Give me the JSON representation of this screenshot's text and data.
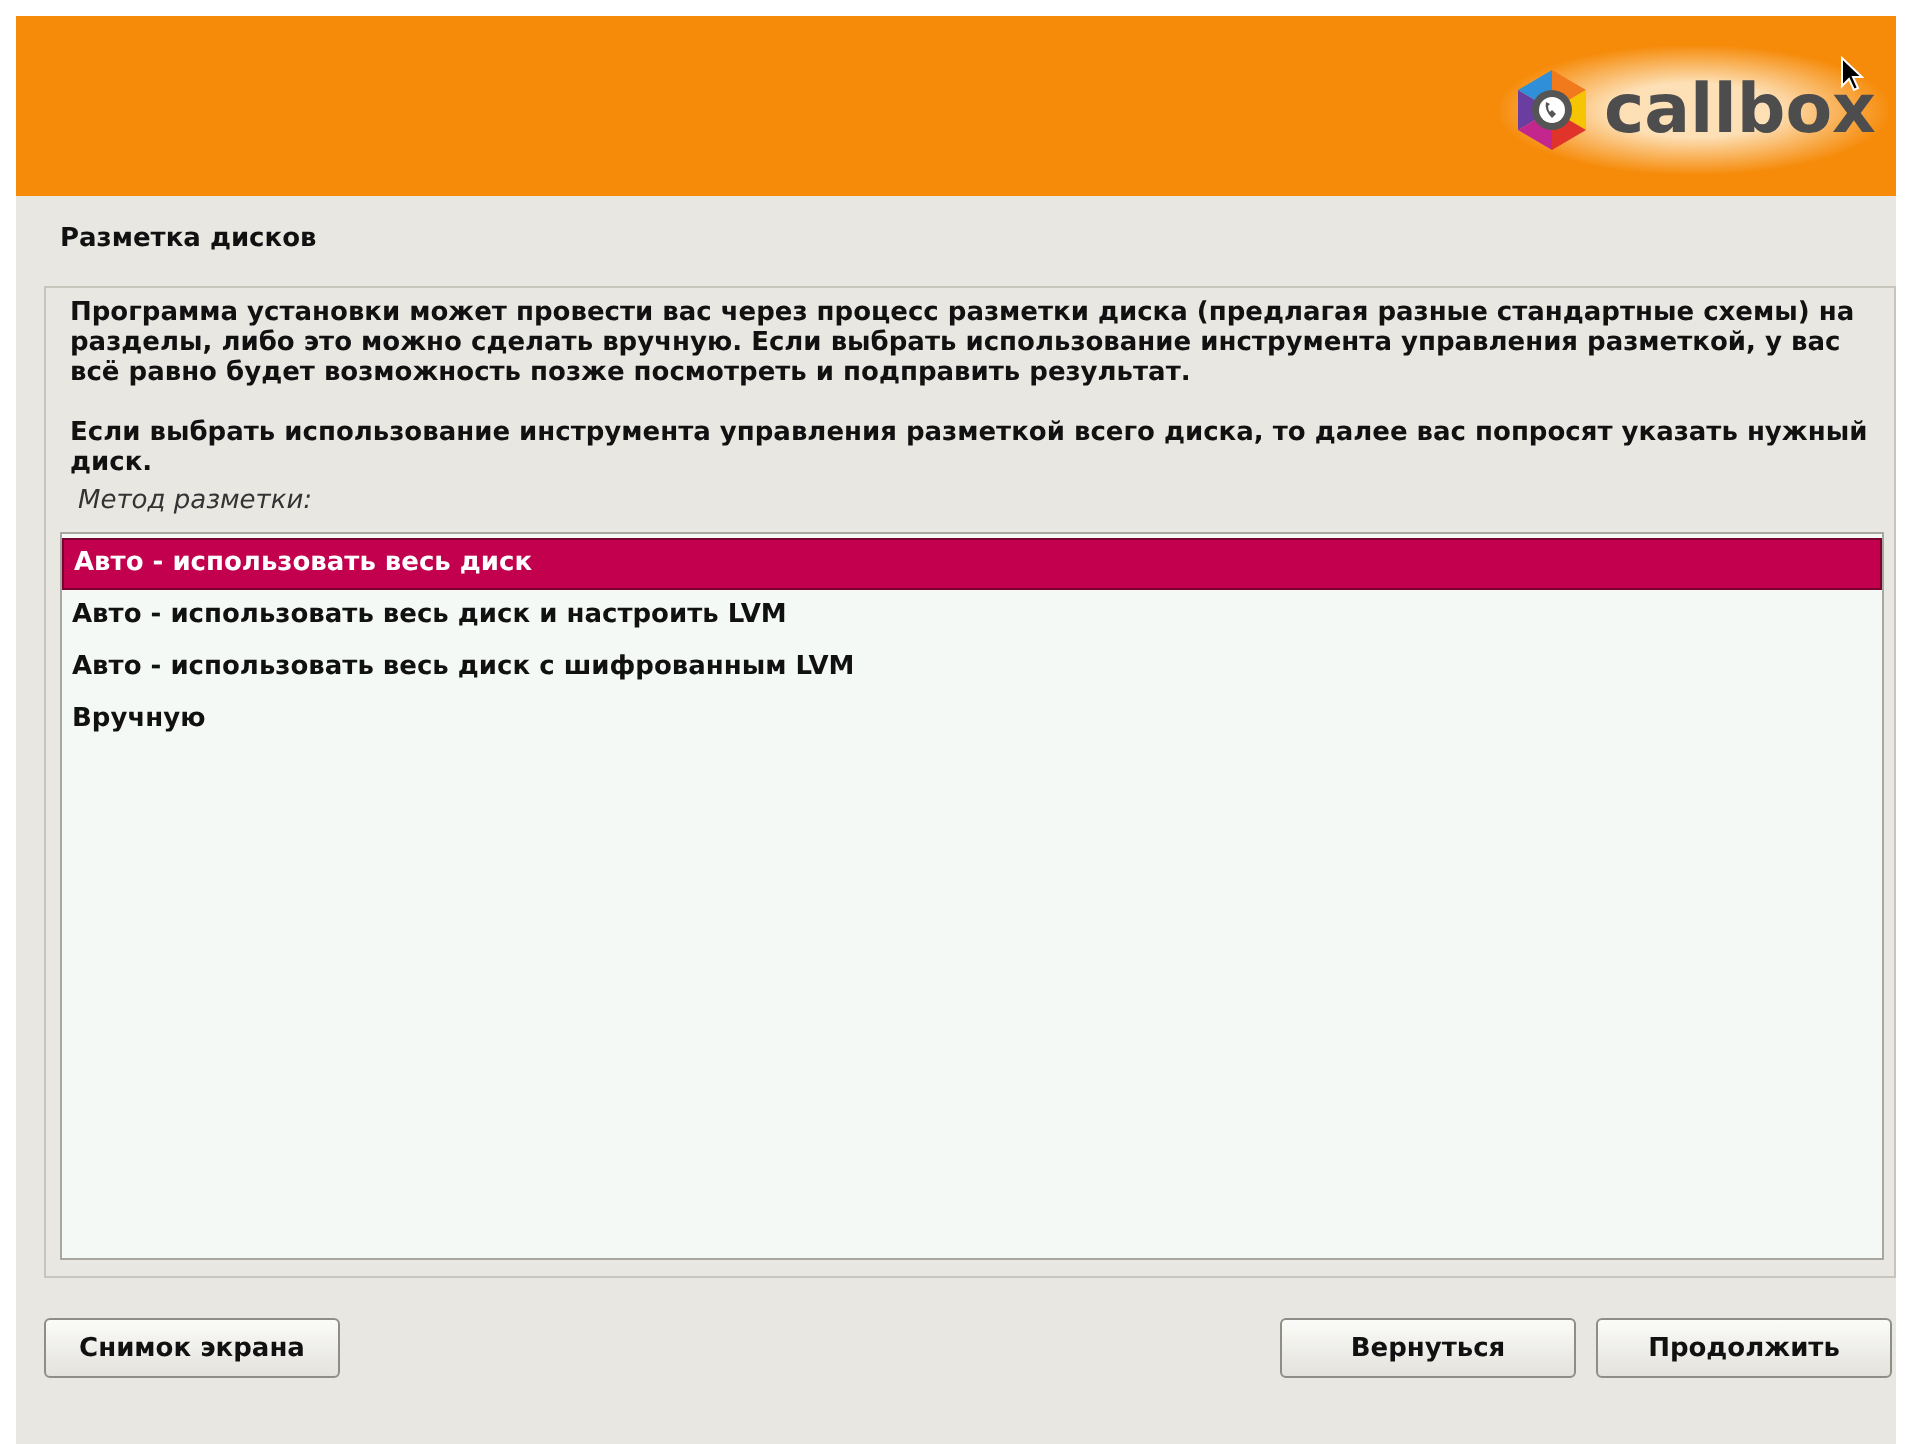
{
  "banner": {
    "logo_text": "callbox"
  },
  "title": "Разметка дисков",
  "paragraphs": [
    "Программа установки может провести вас через процесс разметки диска (предлагая разные стандартные схемы) на разделы, либо это можно сделать вручную. Если выбрать использование инструмента управления разметкой, у вас всё равно будет возможность позже посмотреть и подправить результат.",
    "Если выбрать использование инструмента управления разметкой всего диска, то далее вас попросят указать нужный диск."
  ],
  "list_label": "Метод разметки:",
  "options": [
    {
      "label": "Авто - использовать весь диск",
      "selected": true
    },
    {
      "label": "Авто - использовать весь диск и настроить LVM",
      "selected": false
    },
    {
      "label": "Авто - использовать весь диск с шифрованным LVM",
      "selected": false
    },
    {
      "label": "Вручную",
      "selected": false
    }
  ],
  "buttons_left": [
    "Снимок экрана"
  ],
  "buttons_right": [
    "Вернуться",
    "Продолжить"
  ]
}
